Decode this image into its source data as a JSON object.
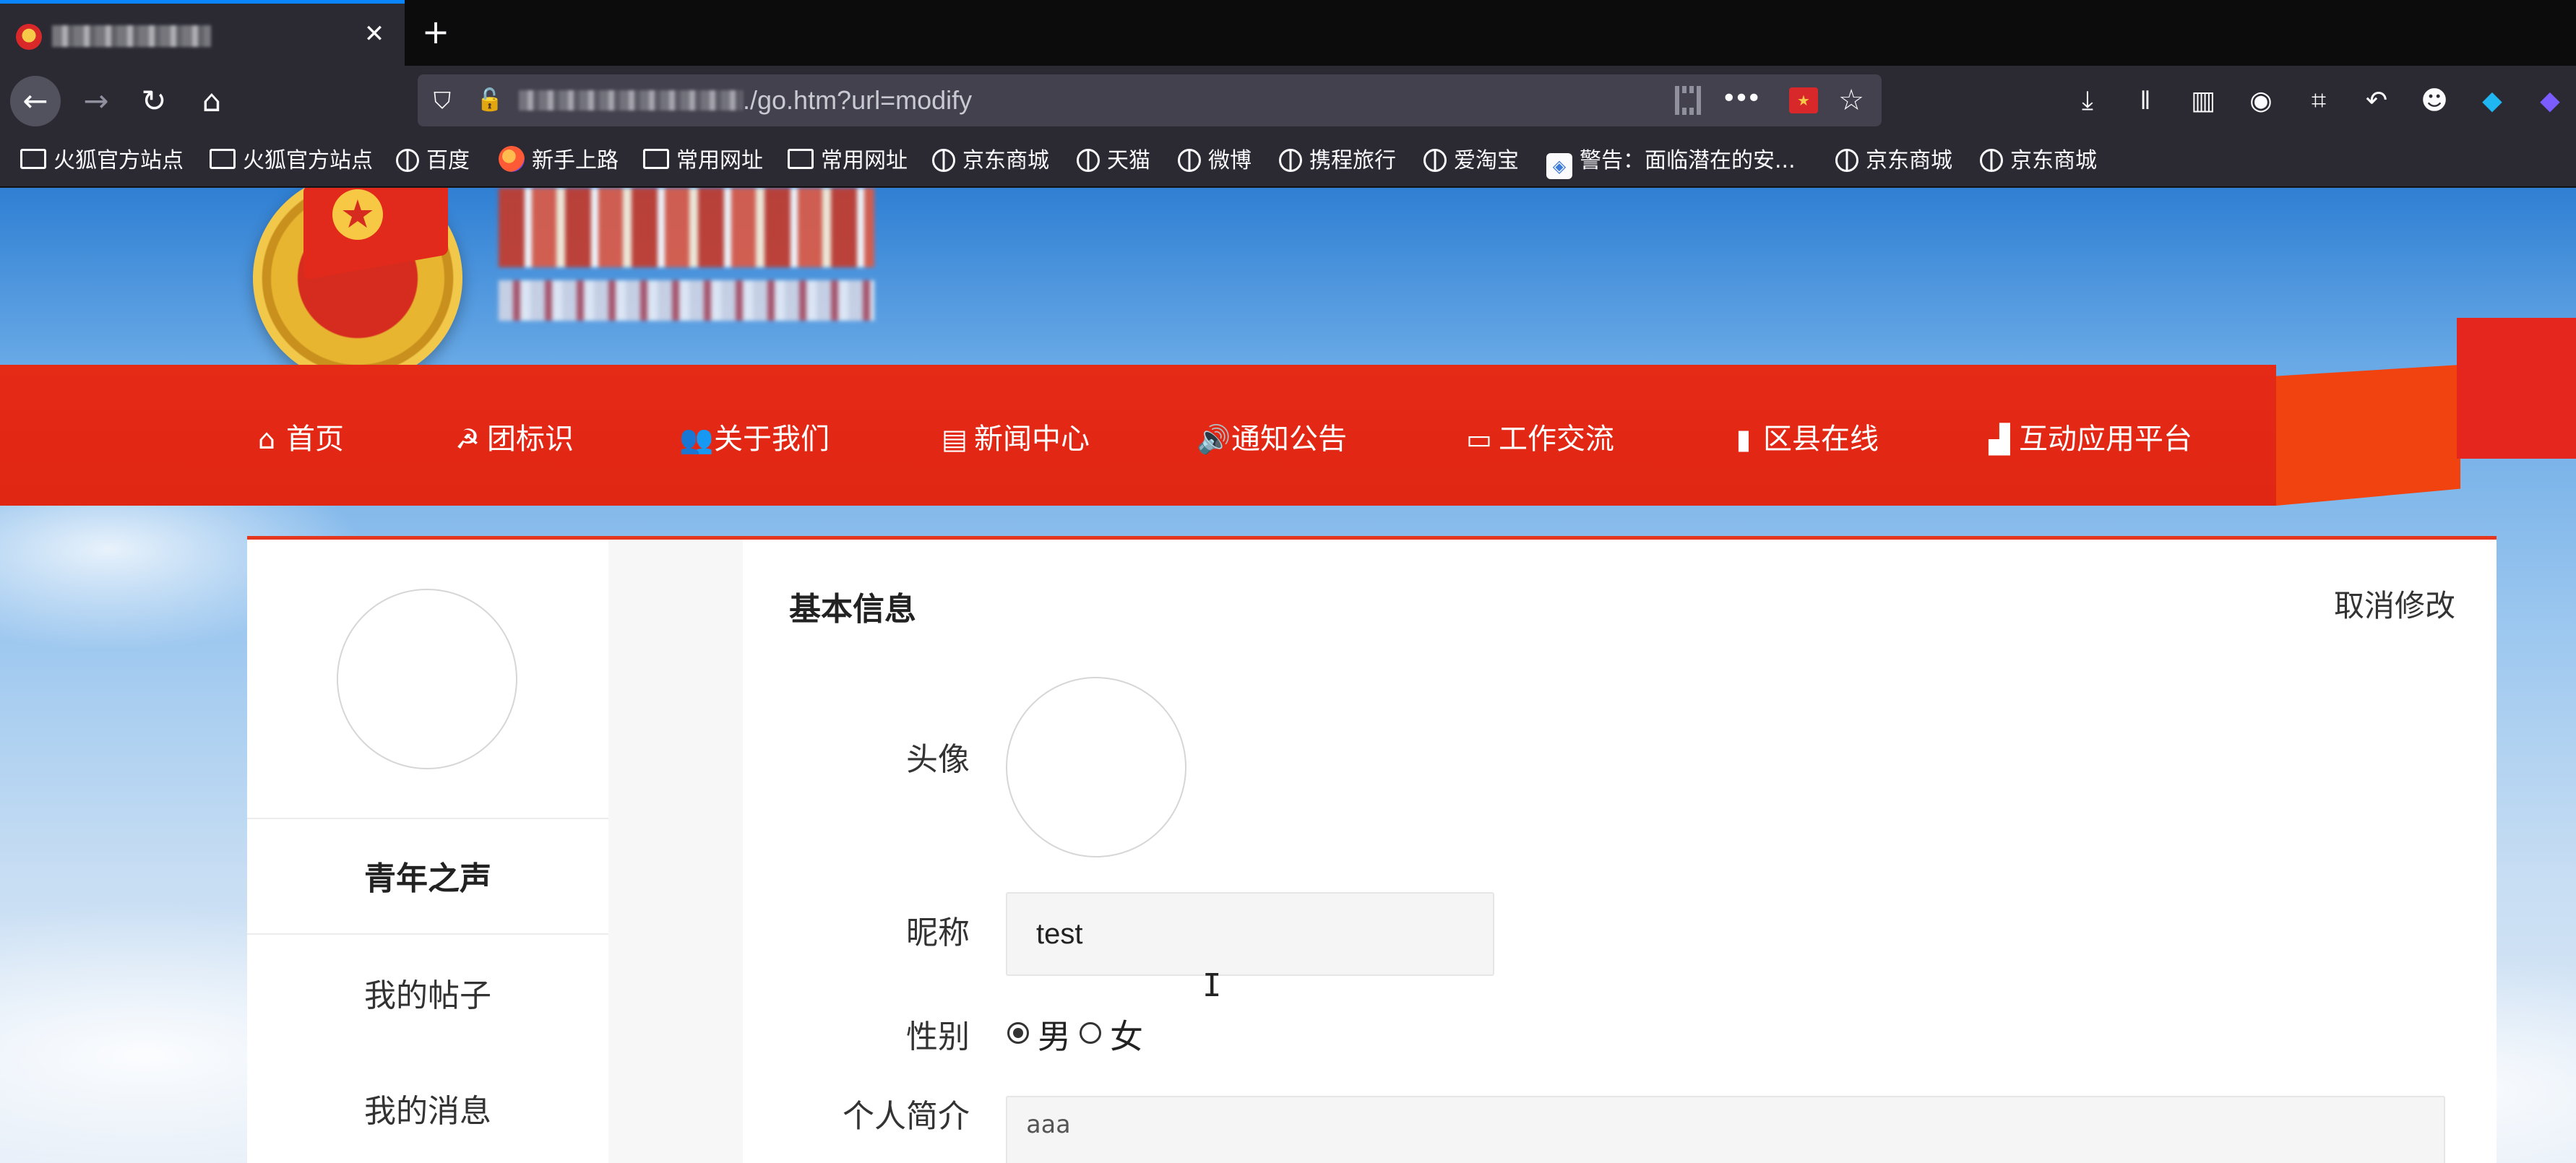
{
  "browser": {
    "tab": {
      "close_glyph": "✕"
    },
    "new_tab_glyph": "+",
    "url": {
      "path": "./go.htm?url=modify"
    },
    "extension_badge": "burp"
  },
  "bookmarks": [
    {
      "label": "火狐官方站点",
      "icon": "folder-icon"
    },
    {
      "label": "火狐官方站点",
      "icon": "folder-icon"
    },
    {
      "label": "百度",
      "icon": "globe-icon"
    },
    {
      "label": "新手上路",
      "icon": "firefox-icon"
    },
    {
      "label": "常用网址",
      "icon": "folder-icon"
    },
    {
      "label": "常用网址",
      "icon": "folder-icon"
    },
    {
      "label": "京东商城",
      "icon": "globe-icon"
    },
    {
      "label": "天猫",
      "icon": "globe-icon"
    },
    {
      "label": "微博",
      "icon": "globe-icon"
    },
    {
      "label": "携程旅行",
      "icon": "globe-icon"
    },
    {
      "label": "爱淘宝",
      "icon": "globe-icon"
    },
    {
      "label": "警告：面临潜在的安...",
      "icon": "warning-icon"
    },
    {
      "label": "京东商城",
      "icon": "globe-icon"
    },
    {
      "label": "京东商城",
      "icon": "globe-icon"
    }
  ],
  "emblem_text": "中国共青团",
  "nav": [
    {
      "label": "首页",
      "icon": "home-icon"
    },
    {
      "label": "团标识",
      "icon": "emblem-icon"
    },
    {
      "label": "关于我们",
      "icon": "users-icon"
    },
    {
      "label": "新闻中心",
      "icon": "news-icon"
    },
    {
      "label": "通知公告",
      "icon": "speaker-icon"
    },
    {
      "label": "工作交流",
      "icon": "monitor-icon"
    },
    {
      "label": "区县在线",
      "icon": "map-icon"
    },
    {
      "label": "互动应用平台",
      "icon": "chart-icon"
    }
  ],
  "sidebar": {
    "items": [
      {
        "label": "青年之声",
        "active": true
      },
      {
        "label": "我的帖子"
      },
      {
        "label": "我的消息"
      }
    ]
  },
  "form": {
    "title": "基本信息",
    "cancel_label": "取消修改",
    "avatar_label": "头像",
    "nickname_label": "昵称",
    "nickname_value": "test",
    "gender_label": "性别",
    "gender_male": "男",
    "gender_female": "女",
    "gender_selected": "男",
    "bio_label": "个人简介",
    "bio_value": "aaa"
  },
  "colors": {
    "nav_red": "#e52a16",
    "ribbon_orange": "#f04310",
    "accent_blue": "#0a84ff"
  }
}
